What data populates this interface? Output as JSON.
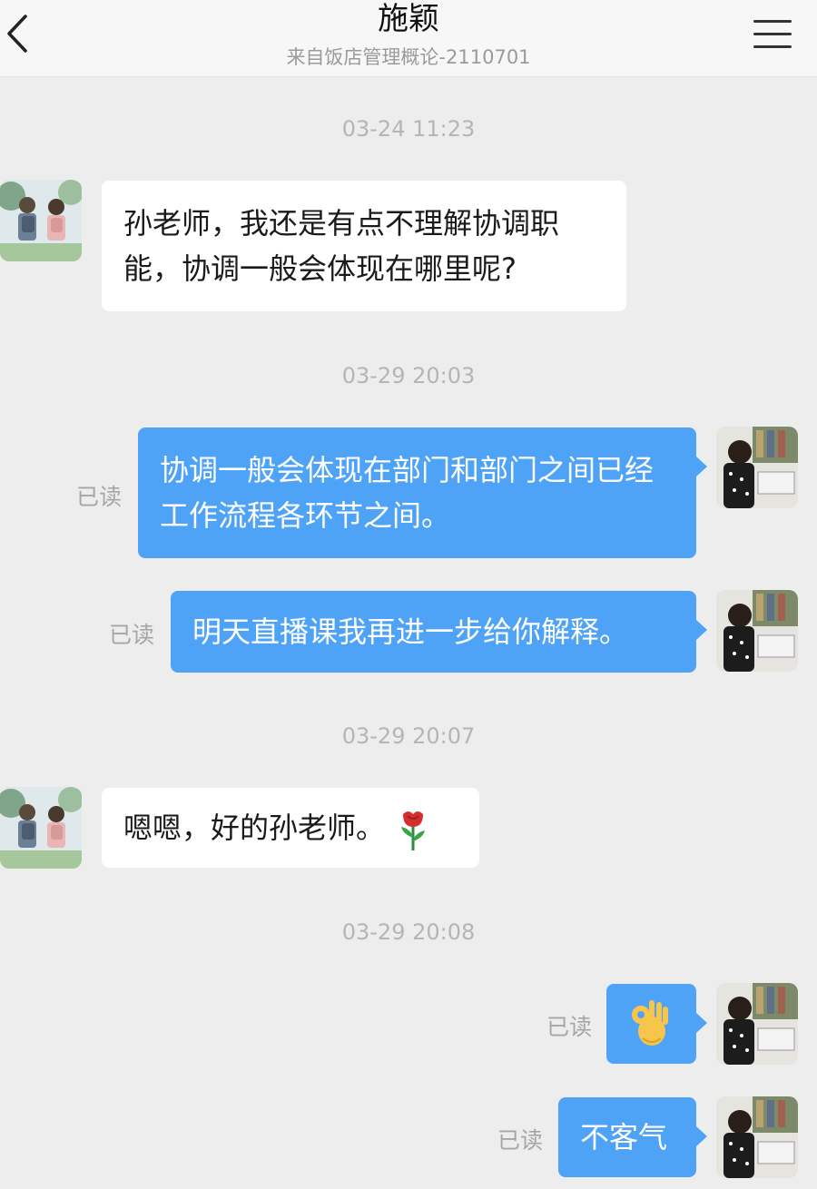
{
  "header": {
    "title": "施颖",
    "subtitle": "来自饭店管理概论-2110701"
  },
  "icons": {
    "back": "chevron-left-icon",
    "menu": "hamburger-menu-icon",
    "flower": "rose-emoji",
    "ok": "ok-hand-emoji"
  },
  "colors": {
    "outgoing_bubble": "#4fa3f7",
    "incoming_bubble": "#ffffff",
    "background": "#ededed"
  },
  "chat": {
    "time1": "03-24 11:23",
    "msg1": "孙老师，我还是有点不理解协调职能，协调一般会体现在哪里呢?",
    "time2": "03-29 20:03",
    "msg2": "协调一般会体现在部门和部门之间已经工作流程各环节之间。",
    "msg2_status": "已读",
    "msg3": "明天直播课我再进一步给你解释。",
    "msg3_status": "已读",
    "time3": "03-29 20:07",
    "msg4": "嗯嗯，好的孙老师。",
    "time4": "03-29 20:08",
    "msg5_status": "已读",
    "msg6": "不客气",
    "msg6_status": "已读"
  }
}
